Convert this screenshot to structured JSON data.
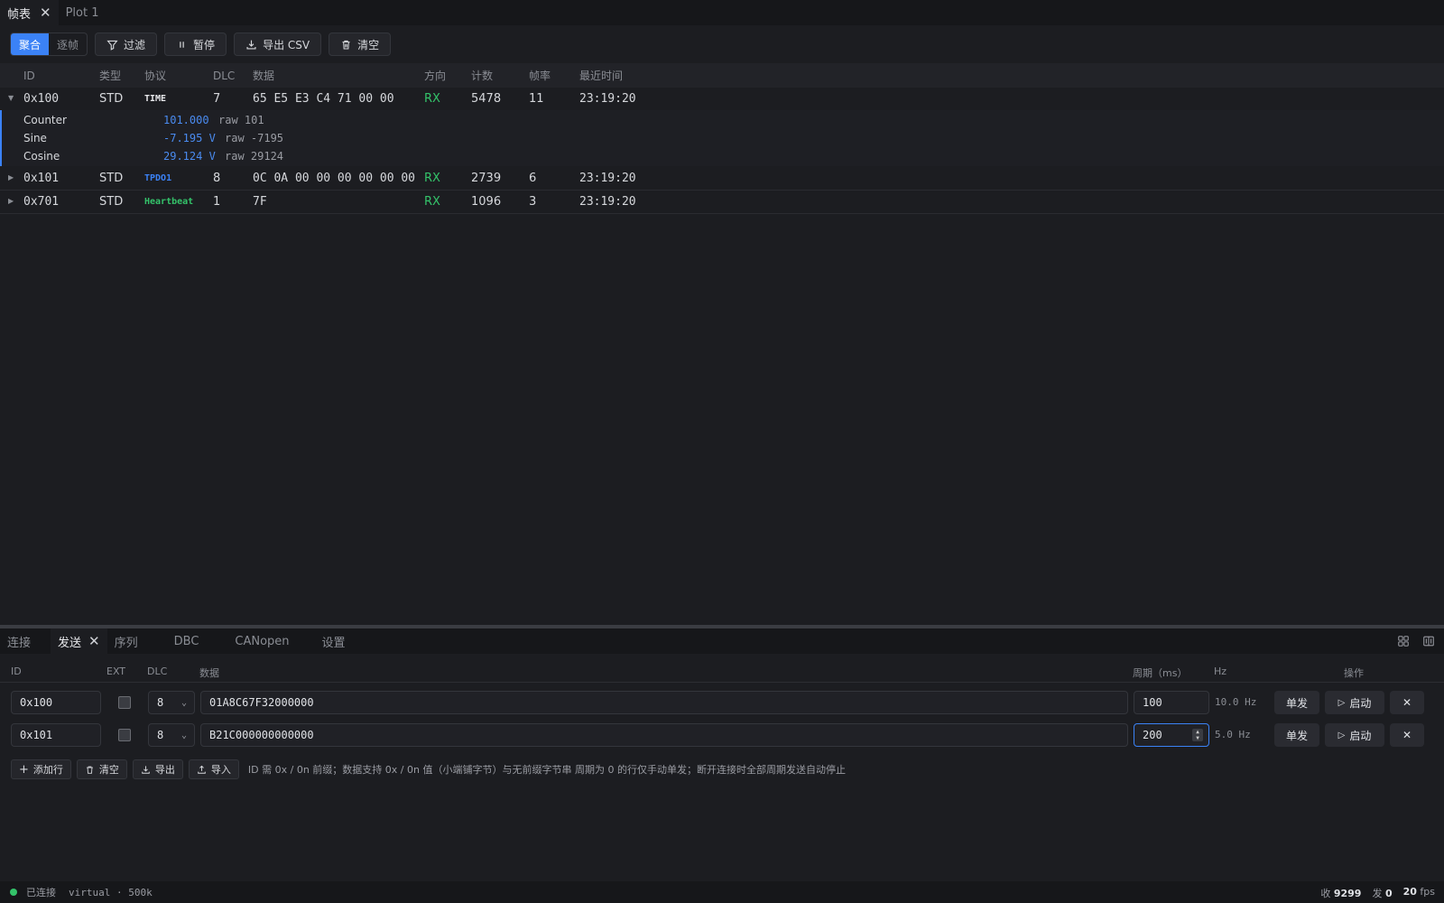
{
  "top_tabs": [
    {
      "label": "帧表"
    },
    {
      "label": "Plot 1"
    }
  ],
  "toolbar": {
    "mode_aggregate": "聚合",
    "mode_per_frame": "逐帧",
    "filter": "过滤",
    "pause": "暂停",
    "export_csv": "导出 CSV",
    "clear": "清空"
  },
  "frame_table": {
    "headers": {
      "id": "ID",
      "type": "类型",
      "protocol": "协议",
      "dlc": "DLC",
      "data": "数据",
      "direction": "方向",
      "count": "计数",
      "rate": "帧率",
      "last_time": "最近时间"
    },
    "rows": [
      {
        "id": "0x100",
        "type": "STD",
        "protocol": "TIME",
        "dlc": "7",
        "data": "65 E5 E3 C4 71 00 00",
        "direction": "RX",
        "count": "5478",
        "rate": "11",
        "last_time": "23:19:20"
      },
      {
        "id": "0x101",
        "type": "STD",
        "protocol": "TPDO1",
        "dlc": "8",
        "data": "0C 0A 00 00 00 00 00 00",
        "direction": "RX",
        "count": "2739",
        "rate": "6",
        "last_time": "23:19:20"
      },
      {
        "id": "0x701",
        "type": "STD",
        "protocol": "Heartbeat",
        "dlc": "1",
        "data": "7F",
        "direction": "RX",
        "count": "1096",
        "rate": "3",
        "last_time": "23:19:20"
      }
    ],
    "signals": [
      {
        "name": "Counter",
        "value": "101.000",
        "raw": "raw 101"
      },
      {
        "name": "Sine",
        "value": "-7.195 V",
        "raw": "raw -7195"
      },
      {
        "name": "Cosine",
        "value": "29.124 V",
        "raw": "raw 29124"
      }
    ]
  },
  "bottom_tabs": [
    {
      "label": "连接"
    },
    {
      "label": "发送"
    },
    {
      "label": "序列"
    },
    {
      "label": "DBC"
    },
    {
      "label": "CANopen"
    },
    {
      "label": "设置"
    }
  ],
  "send": {
    "headers": {
      "id": "ID",
      "ext": "EXT",
      "dlc": "DLC",
      "data": "数据",
      "period": "周期（ms）",
      "hz": "Hz",
      "actions": "操作"
    },
    "rows": [
      {
        "id": "0x100",
        "dlc": "8",
        "data": "01A8C67F32000000",
        "period": "100",
        "hz": "10.0 Hz",
        "single": "单发",
        "start": "启动"
      },
      {
        "id": "0x101",
        "dlc": "8",
        "data": "B21C000000000000",
        "period": "200",
        "hz": "5.0 Hz",
        "single": "单发",
        "start": "启动"
      }
    ],
    "footer": {
      "add_row": "添加行",
      "clear": "清空",
      "export": "导出",
      "import": "导入",
      "hint": "ID 需 0x / 0n 前缀；数据支持 0x / 0n 值（小端铺字节）与无前缀字节串   周期为 0 的行仅手动单发；断开连接时全部周期发送自动停止"
    }
  },
  "status": {
    "connection": "已连接",
    "adapter": "virtual · 500k",
    "rx_label": "收",
    "rx_value": "9299",
    "tx_label": "发",
    "tx_value": "0",
    "fps_value": "20",
    "fps_label": "fps"
  },
  "colors": {
    "accent": "#3b82f6",
    "rx": "#34c36a",
    "heartbeat": "#34c36a",
    "tpdo": "#3b82f6"
  }
}
